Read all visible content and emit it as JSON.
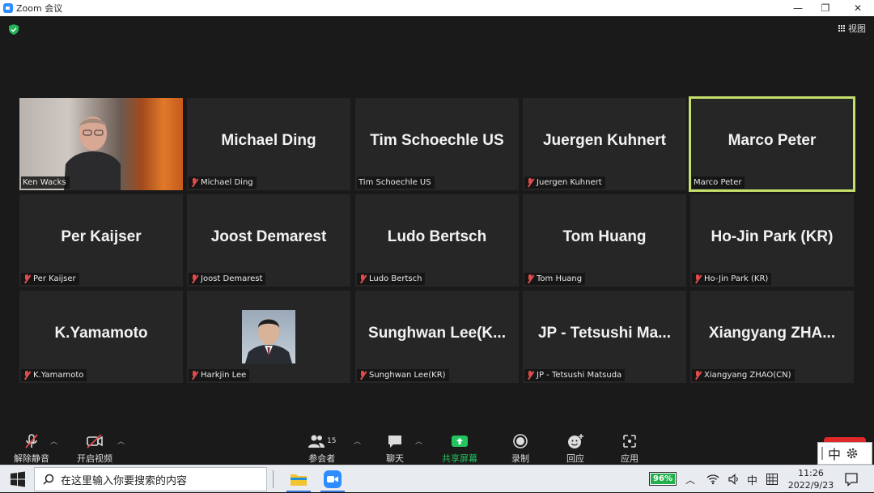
{
  "window": {
    "title": "Zoom 会议",
    "minimize": "—",
    "restore": "❐",
    "close": "✕"
  },
  "view_button": {
    "label": "视图"
  },
  "participants": [
    {
      "tile_name": "",
      "label": "Ken Wacks",
      "muted": false,
      "kind": "video"
    },
    {
      "tile_name": "Michael Ding",
      "label": "Michael Ding",
      "muted": true,
      "kind": "name"
    },
    {
      "tile_name": "Tim Schoechle US",
      "label": "Tim Schoechle US",
      "muted": false,
      "kind": "name"
    },
    {
      "tile_name": "Juergen Kuhnert",
      "label": "Juergen Kuhnert",
      "muted": true,
      "kind": "name"
    },
    {
      "tile_name": "Marco Peter",
      "label": "Marco Peter",
      "muted": false,
      "kind": "name",
      "active": true
    },
    {
      "tile_name": "Per Kaijser",
      "label": "Per Kaijser",
      "muted": true,
      "kind": "name"
    },
    {
      "tile_name": "Joost Demarest",
      "label": "Joost Demarest",
      "muted": true,
      "kind": "name"
    },
    {
      "tile_name": "Ludo Bertsch",
      "label": "Ludo Bertsch",
      "muted": true,
      "kind": "name"
    },
    {
      "tile_name": "Tom Huang",
      "label": "Tom Huang",
      "muted": true,
      "kind": "name"
    },
    {
      "tile_name": "Ho-Jin Park (KR)",
      "label": "Ho-Jin Park (KR)",
      "muted": true,
      "kind": "name"
    },
    {
      "tile_name": "K.Yamamoto",
      "label": "K.Yamamoto",
      "muted": true,
      "kind": "name"
    },
    {
      "tile_name": "",
      "label": "Harkjin Lee",
      "muted": true,
      "kind": "photo"
    },
    {
      "tile_name": "Sunghwan  Lee(K...",
      "label": "Sunghwan Lee(KR)",
      "muted": true,
      "kind": "name"
    },
    {
      "tile_name": "JP  -  Tetsushi Ma...",
      "label": "JP - Tetsushi Matsuda",
      "muted": true,
      "kind": "name"
    },
    {
      "tile_name": "Xiangyang  ZHA...",
      "label": "Xiangyang ZHAO(CN)",
      "muted": true,
      "kind": "name"
    }
  ],
  "toolbar": {
    "unmute": "解除静音",
    "start_video": "开启视频",
    "participants": "参会者",
    "participants_count": "15",
    "chat": "聊天",
    "share": "共享屏幕",
    "record": "录制",
    "reactions": "回应",
    "apps": "应用"
  },
  "ime": {
    "mode": "中"
  },
  "taskbar": {
    "search_placeholder": "在这里输入你要搜索的内容",
    "battery": "96%",
    "input_lang": "中",
    "time": "11:26",
    "date": "2022/9/23"
  },
  "colors": {
    "active_speaker": "#c5e06b",
    "share_green": "#22c55e",
    "muted_red": "#e34b4b"
  }
}
